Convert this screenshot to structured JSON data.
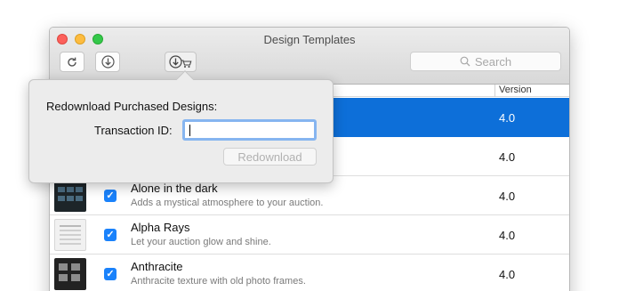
{
  "window": {
    "title": "Design Templates",
    "search_placeholder": "Search"
  },
  "toolbar": {
    "refresh_icon": "refresh-icon",
    "download_icon": "download-icon",
    "redownload_purchases_icon": "download-cart-icon"
  },
  "table": {
    "columns": {
      "version": "Version"
    },
    "rows": [
      {
        "name": "",
        "description": "",
        "version": "4.0",
        "checked": true,
        "selected": true
      },
      {
        "name": "",
        "description": "",
        "version": "4.0",
        "checked": true,
        "selected": false
      },
      {
        "name": "Alone in the dark",
        "description": "Adds a mystical atmosphere to your auction.",
        "version": "4.0",
        "checked": true,
        "selected": false
      },
      {
        "name": "Alpha Rays",
        "description": "Let your auction glow and shine.",
        "version": "4.0",
        "checked": true,
        "selected": false
      },
      {
        "name": "Anthracite",
        "description": "Anthracite texture with old photo frames.",
        "version": "4.0",
        "checked": true,
        "selected": false
      }
    ]
  },
  "popover": {
    "title": "Redownload Purchased Designs:",
    "transaction_label": "Transaction ID:",
    "transaction_value": "",
    "redownload_button": "Redownload",
    "redownload_enabled": false
  },
  "colors": {
    "selection": "#0d6fd9",
    "checkbox": "#1a82fb",
    "close": "#fc605b",
    "minimize": "#fdbc40",
    "maximize": "#34c84a"
  }
}
